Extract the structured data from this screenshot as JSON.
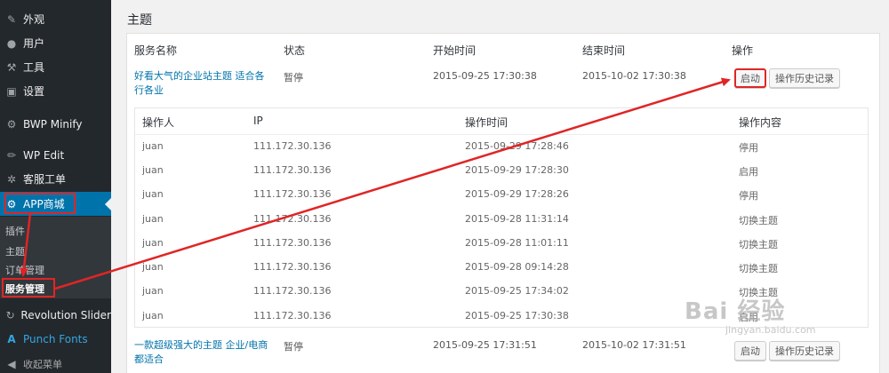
{
  "sidebar": {
    "items": [
      {
        "label": "外观",
        "icon": "paintbrush-icon"
      },
      {
        "label": "用户",
        "icon": "user-icon"
      },
      {
        "label": "工具",
        "icon": "wrench-icon"
      },
      {
        "label": "设置",
        "icon": "settings-icon"
      },
      {
        "label": "BWP Minify",
        "icon": "gear-icon"
      },
      {
        "label": "WP Edit",
        "icon": "pencil-icon"
      },
      {
        "label": "客服工单",
        "icon": "support-icon"
      },
      {
        "label": "APP商城",
        "icon": "gear-icon"
      },
      {
        "label": "Revolution Slider",
        "icon": "refresh-icon"
      },
      {
        "label": "Punch Fonts",
        "icon": "font-icon"
      },
      {
        "label": "收起菜单",
        "icon": "collapse-icon"
      }
    ],
    "submenu": [
      "插件",
      "主题",
      "订单管理",
      "服务管理"
    ]
  },
  "page": {
    "title": "主题"
  },
  "table": {
    "headers": [
      "服务名称",
      "状态",
      "开始时间",
      "结束时间",
      "操作"
    ],
    "rows": [
      {
        "name": "好看大气的企业站主题 适合各行各业",
        "status": "暂停",
        "start": "2015-09-25 17:30:38",
        "end": "2015-10-02 17:30:38",
        "action_primary": "启动",
        "action_history": "操作历史记录"
      },
      {
        "name": "一款超级强大的主题 企业/电商都适合",
        "status": "暂停",
        "start": "2015-09-25 17:31:51",
        "end": "2015-10-02 17:31:51",
        "action_primary": "启动",
        "action_history": "操作历史记录"
      }
    ]
  },
  "history": {
    "headers": [
      "操作人",
      "IP",
      "操作时间",
      "操作内容"
    ],
    "rows": [
      {
        "user": "juan",
        "ip": "111.172.30.136",
        "time": "2015-09-29 17:28:46",
        "action": "停用"
      },
      {
        "user": "juan",
        "ip": "111.172.30.136",
        "time": "2015-09-29 17:28:30",
        "action": "启用"
      },
      {
        "user": "juan",
        "ip": "111.172.30.136",
        "time": "2015-09-29 17:28:26",
        "action": "停用"
      },
      {
        "user": "juan",
        "ip": "111.172.30.136",
        "time": "2015-09-28 11:31:14",
        "action": "切换主题"
      },
      {
        "user": "juan",
        "ip": "111.172.30.136",
        "time": "2015-09-28 11:01:11",
        "action": "切换主题"
      },
      {
        "user": "juan",
        "ip": "111.172.30.136",
        "time": "2015-09-28 09:14:28",
        "action": "切换主题"
      },
      {
        "user": "juan",
        "ip": "111.172.30.136",
        "time": "2015-09-25 17:34:02",
        "action": "切换主题"
      },
      {
        "user": "juan",
        "ip": "111.172.30.136",
        "time": "2015-09-25 17:30:38",
        "action": "启用"
      }
    ]
  },
  "watermark": {
    "main": "Bai 经验",
    "sub": "jingyan.baidu.com"
  },
  "colors": {
    "sidebar": "#23282d",
    "active": "#0073aa",
    "link": "#0073aa",
    "annotation": "#e02525"
  }
}
